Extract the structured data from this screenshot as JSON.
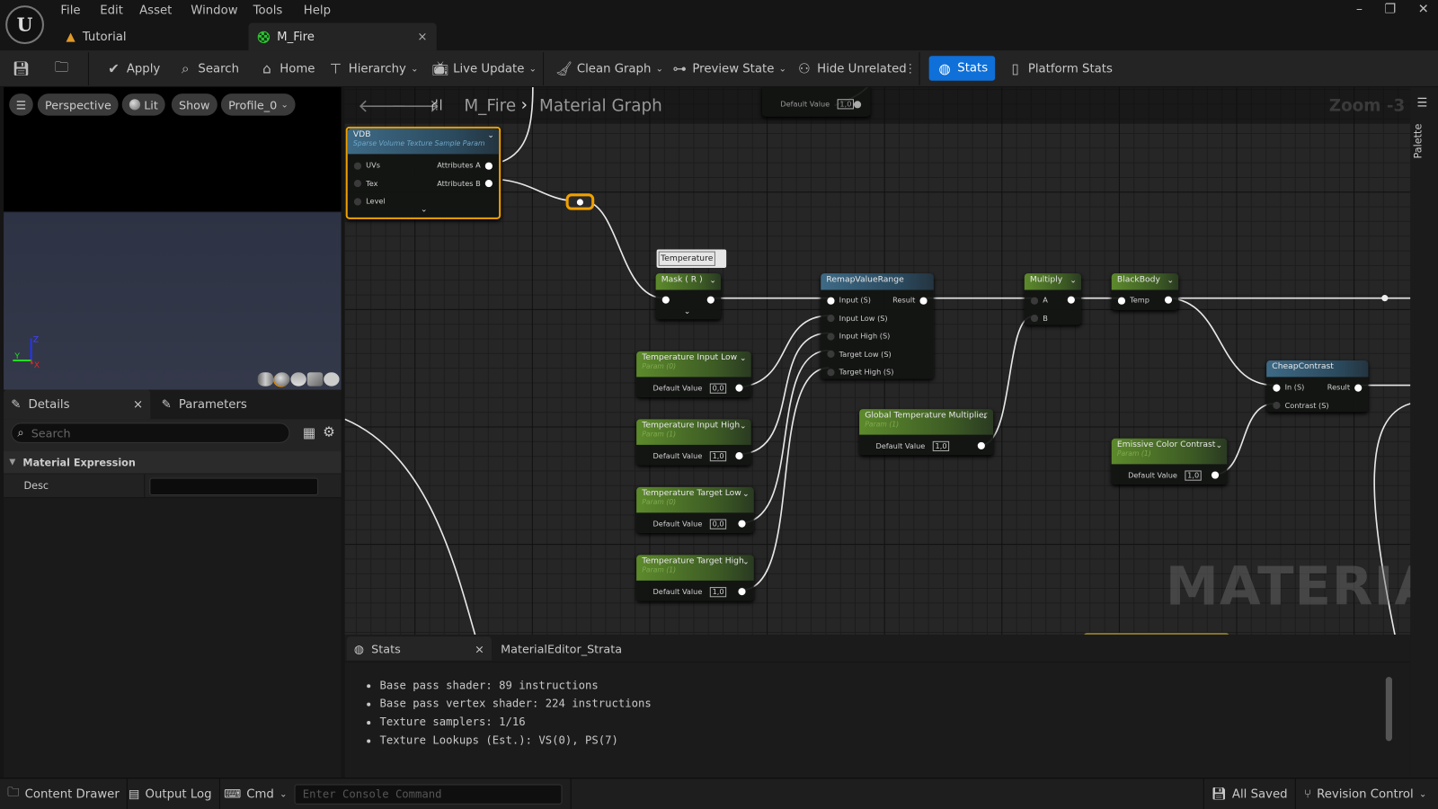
{
  "menu": [
    "File",
    "Edit",
    "Asset",
    "Window",
    "Tools",
    "Help"
  ],
  "tabs": [
    {
      "label": "Tutorial",
      "icon": "level-icon"
    },
    {
      "label": "M_Fire",
      "icon": "material-icon",
      "active": true
    }
  ],
  "window_controls": [
    "minimize",
    "restore",
    "close"
  ],
  "toolbar": {
    "apply": "Apply",
    "search": "Search",
    "home": "Home",
    "hierarchy": "Hierarchy",
    "live_update": "Live Update",
    "clean_graph": "Clean Graph",
    "preview_state": "Preview State",
    "hide_unrelated": "Hide Unrelated",
    "stats": "Stats",
    "platform_stats": "Platform Stats",
    "accent": "#0e70d8"
  },
  "viewport": {
    "perspective": "Perspective",
    "lit": "Lit",
    "show": "Show",
    "profile": "Profile_0",
    "axes": {
      "x": "X",
      "y": "Y",
      "z": "Z"
    }
  },
  "details": {
    "tab_details": "Details",
    "tab_parameters": "Parameters",
    "search_placeholder": "Search",
    "section": "Material Expression",
    "desc_label": "Desc",
    "desc_value": ""
  },
  "graph": {
    "breadcrumb_root": "M_Fire",
    "breadcrumb_leaf": "Material Graph",
    "zoom": "Zoom -3",
    "watermark": "MATERIAL",
    "palette": "Palette",
    "comment": "Temperature",
    "top_node": {
      "label": "Default Value",
      "value": "1,0"
    },
    "nodes": [
      {
        "title": "VDB",
        "subtitle": "Sparse Volume Texture Sample Param",
        "color": "blue",
        "inputs": [
          "UVs",
          "Tex",
          "Level"
        ],
        "outputs": [
          "Attributes A",
          "Attributes B"
        ]
      },
      {
        "title": "Mask ( R )",
        "color": "green",
        "inputs": [
          ""
        ],
        "outputs": [
          ""
        ]
      },
      {
        "title": "RemapValueRange",
        "color": "blue",
        "inputs": [
          "Input (S)",
          "Input Low (S)",
          "Input High (S)",
          "Target Low (S)",
          "Target High (S)"
        ],
        "outputs": [
          "Result"
        ]
      },
      {
        "title": "Multiply",
        "color": "green",
        "inputs": [
          "A",
          "B"
        ],
        "outputs": [
          ""
        ]
      },
      {
        "title": "BlackBody",
        "color": "green",
        "inputs": [
          "Temp"
        ],
        "outputs": [
          ""
        ]
      },
      {
        "title": "CheapContrast",
        "color": "blue",
        "inputs": [
          "In (S)",
          "Contrast (S)"
        ],
        "outputs": [
          "Result"
        ]
      },
      {
        "title": "Temperature Input Low",
        "subtitle": "Param (0)",
        "color": "green",
        "default_label": "Default Value",
        "default_value": "0,0"
      },
      {
        "title": "Temperature Input High",
        "subtitle": "Param (1)",
        "color": "green",
        "default_label": "Default Value",
        "default_value": "1,0"
      },
      {
        "title": "Temperature Target Low",
        "subtitle": "Param (0)",
        "color": "green",
        "default_label": "Default Value",
        "default_value": "0,0"
      },
      {
        "title": "Temperature Target High",
        "subtitle": "Param (1)",
        "color": "green",
        "default_label": "Default Value",
        "default_value": "1,0"
      },
      {
        "title": "Global Temperature Multiplier",
        "subtitle": "Param (1)",
        "color": "green",
        "default_label": "Default Value",
        "default_value": "1,0"
      },
      {
        "title": "Emissive Color Contrast",
        "subtitle": "Param (1)",
        "color": "green",
        "default_label": "Default Value",
        "default_value": "1,0"
      }
    ]
  },
  "stats_panel": {
    "tab_stats": "Stats",
    "tab_strata": "MaterialEditor_Strata",
    "lines": [
      "Base pass shader: 89 instructions",
      "Base pass vertex shader: 224 instructions",
      "Texture samplers: 1/16",
      "Texture Lookups (Est.): VS(0), PS(7)"
    ]
  },
  "statusbar": {
    "content_drawer": "Content Drawer",
    "output_log": "Output Log",
    "cmd": "Cmd",
    "console_placeholder": "Enter Console Command",
    "all_saved": "All Saved",
    "revision_control": "Revision Control"
  }
}
